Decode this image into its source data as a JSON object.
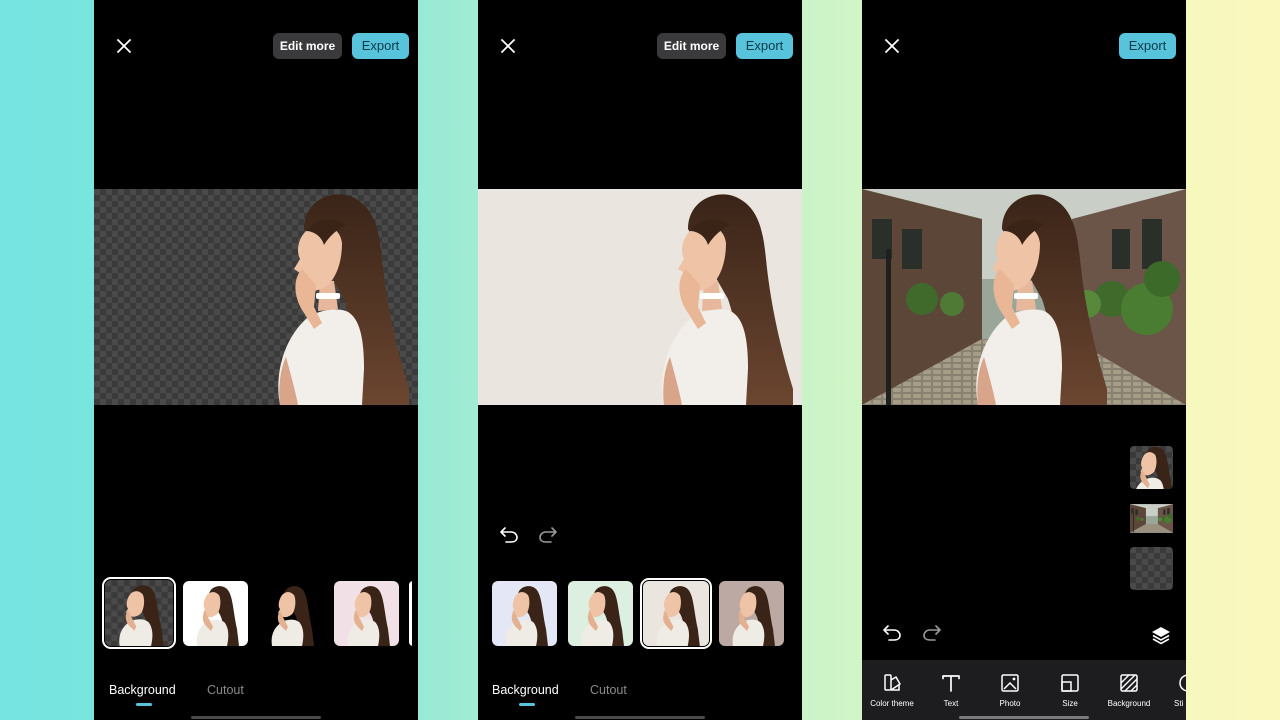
{
  "colors": {
    "accent": "#58c4dc",
    "phone_bg": "#000000",
    "toolbar_bg": "#1d1d1f",
    "beige_bg": "#ebe5df"
  },
  "panel1": {
    "edit_more_label": "Edit more",
    "export_label": "Export",
    "tabs": {
      "background": "Background",
      "cutout": "Cutout"
    },
    "thumbnails": [
      "transparent",
      "white",
      "black",
      "pink",
      "partial"
    ],
    "selected_thumbnail": "transparent"
  },
  "panel2": {
    "edit_more_label": "Edit more",
    "export_label": "Export",
    "tabs": {
      "background": "Background",
      "cutout": "Cutout"
    },
    "thumbnails": [
      "lavender",
      "mint",
      "beige",
      "mauve"
    ],
    "selected_thumbnail": "beige"
  },
  "panel3": {
    "export_label": "Export",
    "layers": [
      "woman",
      "street",
      "transparent"
    ],
    "tools": [
      {
        "label": "Color theme",
        "icon": "color-theme-icon"
      },
      {
        "label": "Text",
        "icon": "text-icon"
      },
      {
        "label": "Photo",
        "icon": "photo-icon"
      },
      {
        "label": "Size",
        "icon": "size-icon"
      },
      {
        "label": "Background",
        "icon": "background-icon"
      },
      {
        "label": "Sti",
        "icon": "sticker-icon"
      }
    ]
  }
}
